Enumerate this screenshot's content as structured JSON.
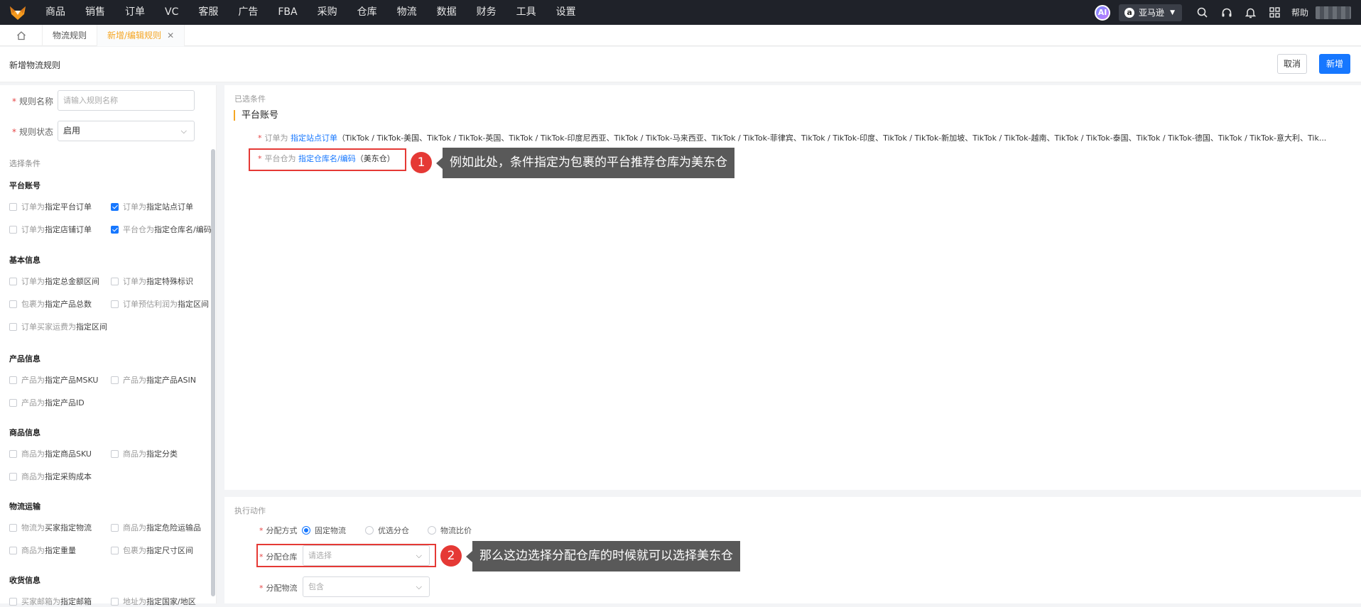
{
  "topnav": {
    "items": [
      "商品",
      "销售",
      "订单",
      "VC",
      "客服",
      "广告",
      "FBA",
      "采购",
      "仓库",
      "物流",
      "数据",
      "财务",
      "工具",
      "设置"
    ],
    "ai_label": "AI",
    "platform": "亚马逊",
    "help": "帮助"
  },
  "tabs": [
    {
      "label": "物流规则"
    },
    {
      "label": "新增/编辑规则",
      "active": true
    }
  ],
  "page": {
    "title": "新增物流规则",
    "cancel_label": "取消",
    "add_label": "新增"
  },
  "form": {
    "name_label": "规则名称",
    "name_placeholder": "请输入规则名称",
    "status_label": "规则状态",
    "status_value": "启用"
  },
  "conditions": {
    "title": "选择条件",
    "groups": [
      {
        "title": "平台账号",
        "items": [
          {
            "pre": "订单为",
            "main": "指定平台订单",
            "checked": false
          },
          {
            "pre": "订单为",
            "main": "指定站点订单",
            "checked": true
          },
          {
            "pre": "订单为",
            "main": "指定店铺订单",
            "checked": false
          },
          {
            "pre": "平台仓为",
            "main": "指定仓库名/编码",
            "checked": true
          }
        ]
      },
      {
        "title": "基本信息",
        "items": [
          {
            "pre": "订单为",
            "main": "指定总金额区间",
            "checked": false
          },
          {
            "pre": "订单为",
            "main": "指定特殊标识",
            "checked": false
          },
          {
            "pre": "包裹为",
            "main": "指定产品总数",
            "checked": false
          },
          {
            "pre": "订单预估利润为",
            "main": "指定区间",
            "checked": false
          },
          {
            "pre": "订单买家运费为",
            "main": "指定区间",
            "checked": false
          }
        ]
      },
      {
        "title": "产品信息",
        "items": [
          {
            "pre": "产品为",
            "main": "指定产品MSKU",
            "checked": false
          },
          {
            "pre": "产品为",
            "main": "指定产品ASIN",
            "checked": false
          },
          {
            "pre": "产品为",
            "main": "指定产品ID",
            "checked": false
          }
        ]
      },
      {
        "title": "商品信息",
        "items": [
          {
            "pre": "商品为",
            "main": "指定商品SKU",
            "checked": false
          },
          {
            "pre": "商品为",
            "main": "指定分类",
            "checked": false
          },
          {
            "pre": "商品为",
            "main": "指定采购成本",
            "checked": false
          }
        ]
      },
      {
        "title": "物流运输",
        "items": [
          {
            "pre": "物流为",
            "main": "买家指定物流",
            "checked": false
          },
          {
            "pre": "商品为",
            "main": "指定危险运输品",
            "checked": false
          },
          {
            "pre": "商品为",
            "main": "指定重量",
            "checked": false
          },
          {
            "pre": "包裹为",
            "main": "指定尺寸区间",
            "checked": false
          }
        ]
      },
      {
        "title": "收货信息",
        "items": [
          {
            "pre": "买家邮箱为",
            "main": "指定邮箱",
            "checked": false
          },
          {
            "pre": "地址为",
            "main": "指定国家/地区",
            "checked": false
          }
        ]
      }
    ]
  },
  "selected": {
    "title": "已选条件",
    "group": "平台账号",
    "line1": {
      "label": "订单为",
      "link": "指定站点订单",
      "value": "（TikTok / TikTok-美国、TikTok / TikTok-英国、TikTok / TikTok-印度尼西亚、TikTok / TikTok-马来西亚、TikTok / TikTok-菲律宾、TikTok / TikTok-印度、TikTok / TikTok-新加坡、TikTok / TikTok-越南、TikTok / TikTok-泰国、TikTok / TikTok-德国、TikTok / TikTok-意大利、Tik..."
    },
    "line2": {
      "label": "平台仓为",
      "link": "指定仓库名/编码",
      "value": "（美东仓）"
    }
  },
  "annotations": [
    {
      "num": "1",
      "text": "例如此处，条件指定为包裹的平台推荐仓库为美东仓"
    },
    {
      "num": "2",
      "text": "那么这边选择分配仓库的时候就可以选择美东仓"
    }
  ],
  "execute": {
    "title": "执行动作",
    "method_label": "分配方式",
    "options": [
      {
        "label": "固定物流",
        "on": true
      },
      {
        "label": "优选分仓",
        "on": false
      },
      {
        "label": "物流比价",
        "on": false
      }
    ],
    "warehouse_label": "分配仓库",
    "warehouse_placeholder": "请选择",
    "logistics_label": "分配物流",
    "logistics_placeholder": "包含"
  },
  "colors": {
    "accent": "#1677ff",
    "warning": "#f5a623",
    "annotation_red": "#e53935"
  }
}
